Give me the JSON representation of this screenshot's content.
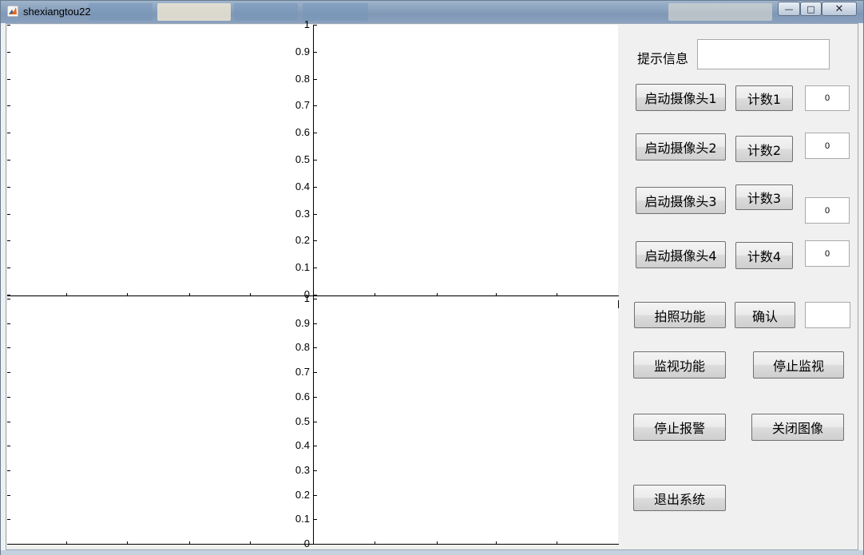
{
  "window": {
    "title": "shexiangtou22",
    "icons": {
      "app": "matlab-icon",
      "minimize": "minimize-icon",
      "maximize": "maximize-icon",
      "close": "close-icon"
    }
  },
  "axes": {
    "y_ticks_top": [
      "1",
      "0.9",
      "0.8",
      "0.7",
      "0.6",
      "0.5",
      "0.4",
      "0.3",
      "0.2",
      "0.1",
      "0"
    ],
    "y_ticks_bottom": [
      "1",
      "0.9",
      "0.8",
      "0.7",
      "0.6",
      "0.5",
      "0.4",
      "0.3",
      "0.2",
      "0.1",
      "0"
    ]
  },
  "panel": {
    "prompt_label": "提示信息",
    "prompt_value": "",
    "cameras": [
      {
        "start_label": "启动摄像头1",
        "count_label": "计数1",
        "count_value": "0"
      },
      {
        "start_label": "启动摄像头2",
        "count_label": "计数2",
        "count_value": "0"
      },
      {
        "start_label": "启动摄像头3",
        "count_label": "计数3",
        "count_value": "0"
      },
      {
        "start_label": "启动摄像头4",
        "count_label": "计数4",
        "count_value": "0"
      }
    ],
    "photo_label": "拍照功能",
    "confirm_label": "确认",
    "confirm_value": "",
    "monitor_label": "监视功能",
    "stop_monitor_label": "停止监视",
    "stop_alarm_label": "停止报警",
    "close_image_label": "关闭图像",
    "exit_label": "退出系统"
  }
}
